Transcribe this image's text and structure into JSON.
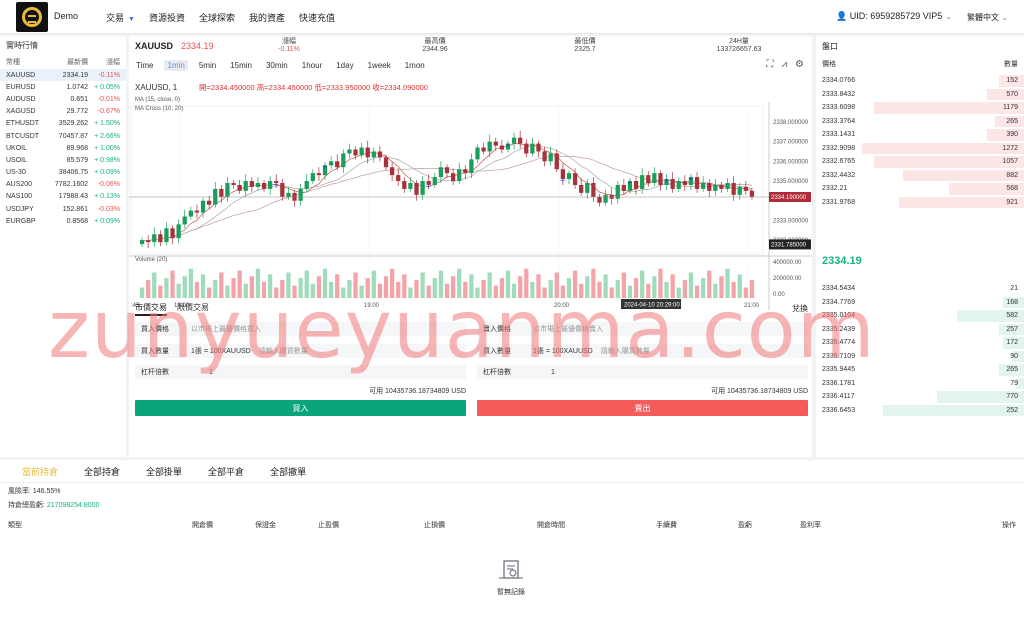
{
  "header": {
    "brand": "Demo",
    "nav": [
      "交易",
      "資源投資",
      "全球探索",
      "我的資產",
      "快速充值"
    ],
    "uid": "UID: 6959285729 VIP5",
    "language": "繁體中文"
  },
  "market_list": {
    "title": "實時行情",
    "columns": [
      "幣種",
      "最新價",
      "漲幅"
    ],
    "rows": [
      {
        "symbol": "XAUUSD",
        "price": "2334.19",
        "change": "-0.11%",
        "dir": "dn"
      },
      {
        "symbol": "EURUSD",
        "price": "1.0742",
        "change": "+ 0.05%",
        "dir": "up"
      },
      {
        "symbol": "AUDUSD",
        "price": "0.651",
        "change": "-0.01%",
        "dir": "dn"
      },
      {
        "symbol": "XAGUSD",
        "price": "29.772",
        "change": "-0.67%",
        "dir": "dn"
      },
      {
        "symbol": "ETHUSDT",
        "price": "3529.262",
        "change": "+ 1.50%",
        "dir": "up"
      },
      {
        "symbol": "BTCUSDT",
        "price": "70457.87",
        "change": "+ 2.66%",
        "dir": "up"
      },
      {
        "symbol": "UKOIL",
        "price": "89.968",
        "change": "+ 1.00%",
        "dir": "up"
      },
      {
        "symbol": "USOIL",
        "price": "85.579",
        "change": "+ 0.98%",
        "dir": "up"
      },
      {
        "symbol": "US-30",
        "price": "38406.75",
        "change": "+ 0.09%",
        "dir": "up"
      },
      {
        "symbol": "AUS200",
        "price": "7782.1602",
        "change": "-0.06%",
        "dir": "dn"
      },
      {
        "symbol": "NAS100",
        "price": "17988.43",
        "change": "+ 0.13%",
        "dir": "up"
      },
      {
        "symbol": "USDJPY",
        "price": "152.861",
        "change": "-0.03%",
        "dir": "dn"
      },
      {
        "symbol": "EURGBP",
        "price": "0.8568",
        "change": "+ 0.09%",
        "dir": "up"
      }
    ]
  },
  "ticker": {
    "symbol": "XAUUSD",
    "price": "2334.19",
    "stats": [
      {
        "label": "漲幅",
        "value": "-0.11%"
      },
      {
        "label": "最高價",
        "value": "2344.96"
      },
      {
        "label": "最低價",
        "value": "2325.7"
      },
      {
        "label": "24H量",
        "value": "133726657.63"
      }
    ]
  },
  "chart_toolbar": {
    "intervals": [
      "Time",
      "1min",
      "5min",
      "15min",
      "30min",
      "1hour",
      "1day",
      "1week",
      "1mon"
    ],
    "active": "1min"
  },
  "chart_data": {
    "type": "candlestick",
    "legend": "XAUUSD, 1",
    "ohlc_text": "開=2334.450000  高=2334.450000  低=2333.950000  收=2334.090000",
    "indicators": [
      "MA (15, close, 0)",
      "MA Cross (10, 20)"
    ],
    "price_ticks": [
      "2338.000000",
      "2337.000000",
      "2336.000000",
      "2335.000000",
      "2333.000000",
      "2332.000000"
    ],
    "current_price_label": "2334.190000",
    "low_label": "2331.785000",
    "ylim": [
      2331.5,
      2338.3
    ],
    "time_ticks": [
      "18:00",
      "19:00",
      "20:00",
      "21:00"
    ],
    "time_left_label": ":45",
    "crosshair_time": "2024-04-10 20:29:00",
    "volume_label": "Volume (20)",
    "volume_ticks": [
      "400000.00",
      "200000.00",
      "0.00"
    ],
    "closes": [
      2332.0,
      2331.9,
      2332.3,
      2331.9,
      2332.6,
      2332.1,
      2332.8,
      2333.2,
      2333.5,
      2333.4,
      2334.0,
      2333.8,
      2334.6,
      2334.2,
      2334.9,
      2334.8,
      2334.5,
      2335.0,
      2334.7,
      2334.9,
      2334.6,
      2335.0,
      2334.9,
      2334.2,
      2334.4,
      2334.0,
      2334.6,
      2335.0,
      2335.4,
      2335.3,
      2335.8,
      2336.0,
      2335.7,
      2336.4,
      2336.6,
      2336.3,
      2336.7,
      2336.2,
      2336.5,
      2336.2,
      2335.7,
      2335.3,
      2335.0,
      2334.6,
      2334.9,
      2334.3,
      2335.0,
      2334.8,
      2335.2,
      2335.7,
      2335.4,
      2335.0,
      2335.6,
      2335.4,
      2336.1,
      2336.7,
      2336.5,
      2337.0,
      2336.8,
      2336.6,
      2336.9,
      2337.2,
      2336.9,
      2336.4,
      2336.9,
      2336.5,
      2336.0,
      2336.4,
      2335.6,
      2335.1,
      2335.4,
      2334.8,
      2334.4,
      2334.9,
      2334.2,
      2333.9,
      2334.3,
      2334.1,
      2334.8,
      2334.5,
      2335.0,
      2334.6,
      2335.3,
      2334.9,
      2335.4,
      2334.8,
      2335.1,
      2334.6,
      2335.0,
      2334.8,
      2335.2,
      2334.6,
      2334.9,
      2334.5,
      2334.8,
      2334.6,
      2334.9,
      2334.3,
      2334.7,
      2334.5,
      2334.2
    ]
  },
  "trade": {
    "tabs": [
      "市價交易",
      "限價交易"
    ],
    "swap": "兌換",
    "buy_form": {
      "price_label": "買入價格",
      "price_placeholder": "以市場上最優價格買入",
      "qty_label": "買入數量",
      "qty_unit": "1張 = 100XAUUSD",
      "qty_placeholder": "請輸入購買數量",
      "lev_label": "杠杆倍數",
      "lev_value": "1",
      "available": "可用 10435736.18734809 USD",
      "button": "買入"
    },
    "sell_form": {
      "price_label": "賣入價格",
      "price_placeholder": "以市場上最優價格賣入",
      "qty_label": "買入數量",
      "qty_unit": "1張 = 100XAUUSD",
      "qty_placeholder": "請輸入購買數量",
      "lev_label": "杠杆倍數",
      "lev_value": "1",
      "available": "可用 10435736.18734809 USD",
      "button": "賣出"
    }
  },
  "orderbook": {
    "title": "盤口",
    "columns": [
      "價格",
      "數量"
    ],
    "mid_price": "2334.19",
    "asks": [
      {
        "price": "2334.0766",
        "qty": "152",
        "depth": 0.12
      },
      {
        "price": "2333.8432",
        "qty": "570",
        "depth": 0.18
      },
      {
        "price": "2333.6098",
        "qty": "1179",
        "depth": 0.72
      },
      {
        "price": "2333.3764",
        "qty": "265",
        "depth": 0.14
      },
      {
        "price": "2333.1431",
        "qty": "390",
        "depth": 0.18
      },
      {
        "price": "2332.9098",
        "qty": "1272",
        "depth": 0.78
      },
      {
        "price": "2332.6765",
        "qty": "1057",
        "depth": 0.72
      },
      {
        "price": "2332.4432",
        "qty": "882",
        "depth": 0.58
      },
      {
        "price": "2332.21",
        "qty": "568",
        "depth": 0.36
      },
      {
        "price": "2331.9768",
        "qty": "921",
        "depth": 0.6
      }
    ],
    "bids": [
      {
        "price": "2334.5434",
        "qty": "21",
        "depth": 0.0
      },
      {
        "price": "2334.7769",
        "qty": "168",
        "depth": 0.1
      },
      {
        "price": "2335.0104",
        "qty": "582",
        "depth": 0.32
      },
      {
        "price": "2335.2439",
        "qty": "257",
        "depth": 0.12
      },
      {
        "price": "2335.4774",
        "qty": "172",
        "depth": 0.1
      },
      {
        "price": "2335.7109",
        "qty": "90",
        "depth": 0.06
      },
      {
        "price": "2335.9445",
        "qty": "265",
        "depth": 0.12
      },
      {
        "price": "2336.1781",
        "qty": "79",
        "depth": 0.04
      },
      {
        "price": "2336.4117",
        "qty": "770",
        "depth": 0.42
      },
      {
        "price": "2336.6453",
        "qty": "252",
        "depth": 0.68
      }
    ]
  },
  "positions": {
    "tabs": [
      "當前持倉",
      "全部持倉",
      "全部掛單",
      "全部平倉",
      "全部撤單"
    ],
    "risk_rate": "風險率: 146.55%",
    "pnl_label": "持倉總盈虧:",
    "pnl_value": "217098254.8000",
    "columns": [
      "類型",
      "開倉價",
      "保證金",
      "止盈價",
      "止損價",
      "開倉時間",
      "手續費",
      "盈虧",
      "盈利率",
      "操作"
    ],
    "empty_text": "暫無記錄"
  },
  "watermark": "zunyueyuanma.com"
}
